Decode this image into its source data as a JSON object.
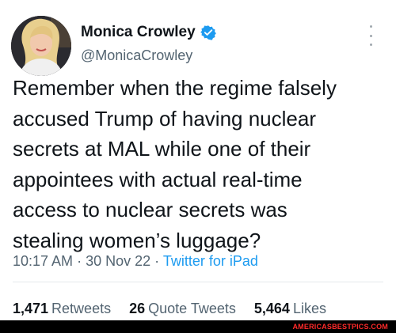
{
  "tweet": {
    "author_name": "Monica Crowley",
    "author_handle": "@MonicaCrowley",
    "verified": true,
    "text": "Remember when the regime falsely\naccused Trump of having nuclear\nsecrets at MAL while one of their\nappointees with actual real-time\naccess to nuclear secrets was\nstealing women’s luggage?",
    "time": "10:17 AM",
    "date": "30 Nov 22",
    "source": "Twitter for iPad",
    "separator": "·"
  },
  "stats": {
    "retweets_count": "1,471",
    "retweets_label": "Retweets",
    "quotes_count": "26",
    "quotes_label": "Quote Tweets",
    "likes_count": "5,464",
    "likes_label": "Likes"
  },
  "watermark": "AMERICASBESTPICS.COM",
  "icons": {
    "verified": "verified-badge-icon",
    "more": "more-options-icon"
  },
  "colors": {
    "text": "#0f1419",
    "secondary": "#536471",
    "link": "#1d9bf0",
    "watermark": "#ff2a2a"
  }
}
